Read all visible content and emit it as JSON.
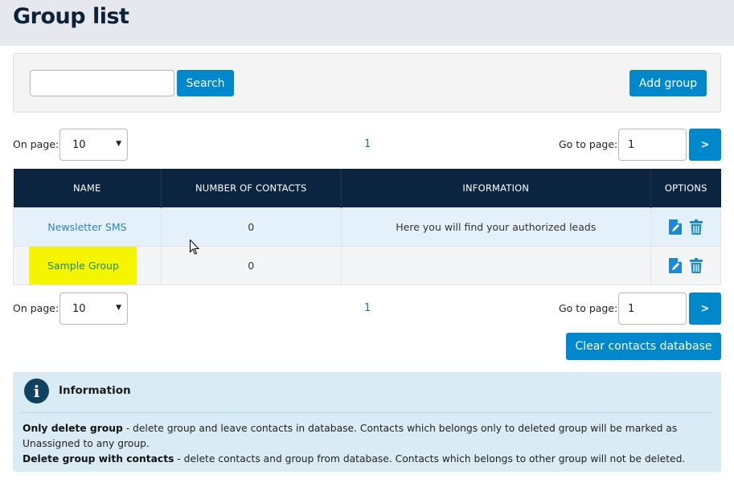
{
  "header": {
    "title": "Group list"
  },
  "search": {
    "value": "",
    "placeholder": "",
    "button_label": "Search"
  },
  "toolbar": {
    "add_group_label": "Add group"
  },
  "pagination": {
    "on_page_label": "On page:",
    "on_page_value": "10",
    "current_page": "1",
    "goto_label": "Go to page:",
    "goto_value": "1",
    "goto_button": ">"
  },
  "table": {
    "columns": [
      "NAME",
      "NUMBER OF CONTACTS",
      "INFORMATION",
      "OPTIONS"
    ],
    "rows": [
      {
        "name": "Newsletter SMS",
        "contacts": "0",
        "information": "Here you will find your authorized leads",
        "highlighted": false
      },
      {
        "name": "Sample Group",
        "contacts": "0",
        "information": "",
        "highlighted": true
      }
    ],
    "row_icons": [
      "edit-document-icon",
      "trash-icon"
    ]
  },
  "actions": {
    "clear_label": "Clear contacts database"
  },
  "info": {
    "icon": "info-icon",
    "title": "Information",
    "line1_bold": "Only delete group",
    "line1_text": " - delete group and leave contacts in database. Contacts which belongs only to deleted group will be marked as Unassigned to any group.",
    "line2_bold": "Delete group with contacts",
    "line2_text": " - delete contacts and group from database. Contacts which belongs to other group will not be deleted."
  },
  "colors": {
    "accent": "#0088cc",
    "table_header": "#0b2440",
    "highlight": "#f5f500",
    "info_bg": "#d9ebf5"
  }
}
